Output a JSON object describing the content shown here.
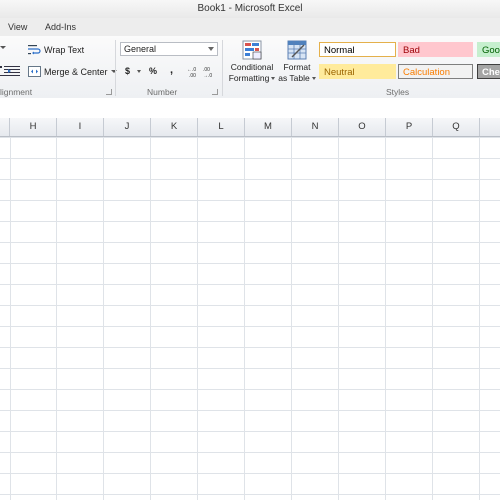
{
  "window": {
    "title": "Book1 - Microsoft Excel"
  },
  "menu": {
    "items": [
      "View",
      "Add-Ins"
    ]
  },
  "ribbon": {
    "alignment": {
      "label": "lignment",
      "wrap_text": "Wrap Text",
      "merge_center": "Merge & Center"
    },
    "number": {
      "label": "Number",
      "format_value": "General",
      "currency": "$",
      "percent": "%",
      "comma": ",",
      "inc_dec": ".0→.00",
      "dec_dec": ".00→.0"
    },
    "styles": {
      "label": "Styles",
      "conditional_formatting": [
        "Conditional",
        "Formatting"
      ],
      "format_as_table": [
        "Format",
        "as Table"
      ],
      "cells": [
        {
          "name": "Normal",
          "bg": "#ffffff",
          "fg": "#000000",
          "border": "#e4b04b"
        },
        {
          "name": "Bad",
          "bg": "#ffc7ce",
          "fg": "#9c0006",
          "border": "#ffc7ce"
        },
        {
          "name": "Good",
          "bg": "#c6efce",
          "fg": "#006100",
          "border": "#c6efce"
        },
        {
          "name": "Neutral",
          "bg": "#ffeb9c",
          "fg": "#9c6500",
          "border": "#ffeb9c"
        },
        {
          "name": "Calculation",
          "bg": "#f2f2f2",
          "fg": "#fa7d00",
          "border": "#7f7f7f"
        },
        {
          "name": "Check Cell",
          "bg": "#a5a5a5",
          "fg": "#ffffff",
          "border": "#3f3f3f"
        }
      ]
    }
  },
  "sheet": {
    "columns": [
      "H",
      "I",
      "J",
      "K",
      "L",
      "M",
      "N",
      "O",
      "P",
      "Q"
    ]
  }
}
